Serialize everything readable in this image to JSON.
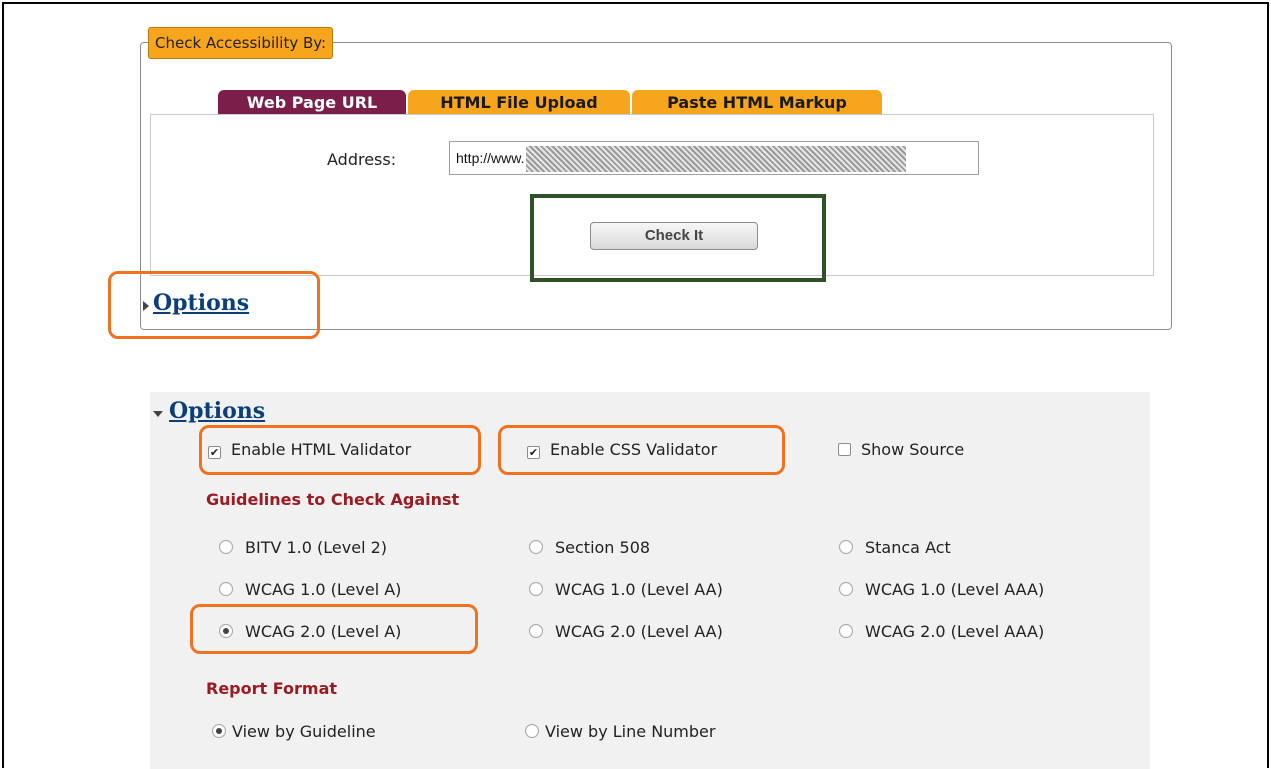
{
  "form": {
    "legend": "Check Accessibility By:",
    "tabs": [
      {
        "label": "Web Page URL",
        "active": true
      },
      {
        "label": "HTML File Upload",
        "active": false
      },
      {
        "label": "Paste HTML Markup",
        "active": false
      }
    ],
    "address_label": "Address:",
    "address_value": "http://www.",
    "check_button": "Check It",
    "options_link": "Options"
  },
  "options_panel": {
    "title": "Options",
    "checkboxes": [
      {
        "label": "Enable HTML Validator",
        "checked": true
      },
      {
        "label": "Enable CSS Validator",
        "checked": true
      },
      {
        "label": "Show Source",
        "checked": false
      }
    ],
    "guidelines_heading": "Guidelines to Check Against",
    "guidelines": [
      {
        "label": "BITV 1.0 (Level 2)",
        "selected": false
      },
      {
        "label": "Section 508",
        "selected": false
      },
      {
        "label": "Stanca Act",
        "selected": false
      },
      {
        "label": "WCAG 1.0 (Level A)",
        "selected": false
      },
      {
        "label": "WCAG 1.0 (Level AA)",
        "selected": false
      },
      {
        "label": "WCAG 1.0 (Level AAA)",
        "selected": false
      },
      {
        "label": "WCAG 2.0 (Level A)",
        "selected": true
      },
      {
        "label": "WCAG 2.0 (Level AA)",
        "selected": false
      },
      {
        "label": "WCAG 2.0 (Level AAA)",
        "selected": false
      }
    ],
    "report_heading": "Report Format",
    "report_options": [
      {
        "label": "View by Guideline",
        "selected": true
      },
      {
        "label": "View by Line Number",
        "selected": false
      }
    ]
  },
  "colors": {
    "tab_active": "#7b1e49",
    "tab_inactive": "#f7a51c",
    "highlight_orange": "#f07220",
    "highlight_green": "#2e5226",
    "heading_red": "#9b1b22",
    "link_blue": "#0a3f7a"
  },
  "icons": {
    "collapsed": "triangle-right-icon",
    "expanded": "triangle-down-icon",
    "checkbox": "checkbox-icon",
    "radio": "radio-icon"
  }
}
